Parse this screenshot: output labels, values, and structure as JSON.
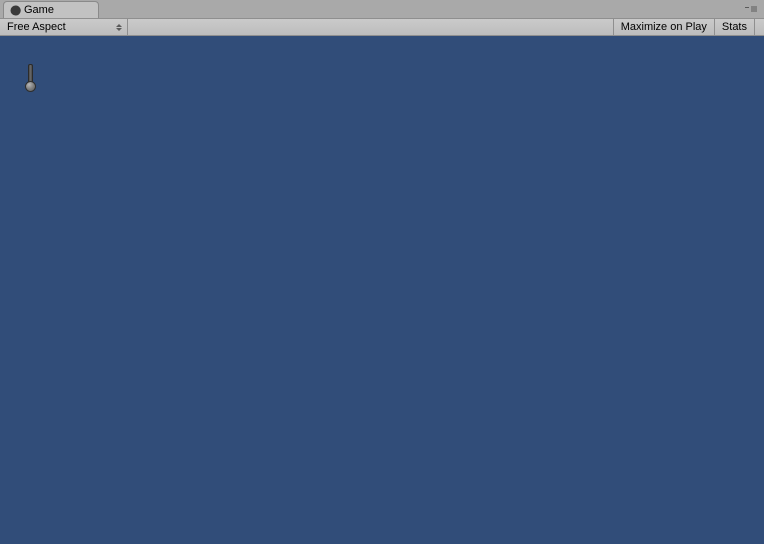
{
  "tab": {
    "label": "Game"
  },
  "toolbar": {
    "aspect_label": "Free Aspect",
    "maximize_label": "Maximize on Play",
    "stats_label": "Stats"
  },
  "colors": {
    "viewport_bg": "#314d79",
    "panel_bg": "#a9a9a9"
  }
}
